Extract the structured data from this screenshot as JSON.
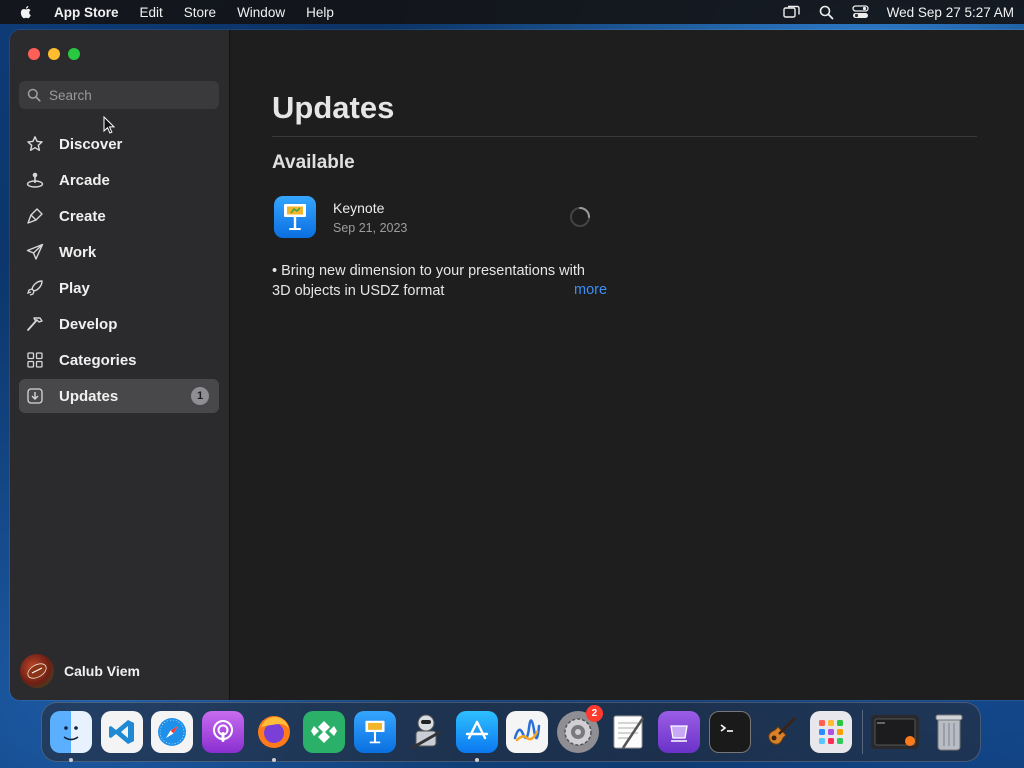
{
  "menubar": {
    "app_name": "App Store",
    "items": [
      "Edit",
      "Store",
      "Window",
      "Help"
    ],
    "clock": "Wed Sep 27  5:27 AM"
  },
  "sidebar": {
    "search_placeholder": "Search",
    "items": [
      {
        "label": "Discover",
        "icon": "star-icon"
      },
      {
        "label": "Arcade",
        "icon": "joystick-icon"
      },
      {
        "label": "Create",
        "icon": "brush-icon"
      },
      {
        "label": "Work",
        "icon": "paper-plane-icon"
      },
      {
        "label": "Play",
        "icon": "rocket-icon"
      },
      {
        "label": "Develop",
        "icon": "hammer-icon"
      },
      {
        "label": "Categories",
        "icon": "grid-icon"
      },
      {
        "label": "Updates",
        "icon": "download-icon",
        "badge": "1",
        "selected": true
      }
    ],
    "user": {
      "name": "Calub Viem"
    }
  },
  "main": {
    "title": "Updates",
    "section": "Available",
    "app": {
      "name": "Keynote",
      "date": "Sep 21, 2023",
      "notes_line1": "• Bring new dimension to your presentations with",
      "notes_line2": "3D objects in USDZ format",
      "more": "more"
    }
  },
  "dock": {
    "apps": [
      "finder-icon",
      "vscode-icon",
      "safari-icon",
      "podcasts-icon",
      "firefox-icon",
      "tableplus-icon",
      "keynote-icon",
      "automator-icon",
      "app-store-icon",
      "freeform-icon",
      "system-settings-icon",
      "textedit-icon",
      "multipass-icon",
      "terminal-icon",
      "garageband-icon",
      "launchpad-icon"
    ],
    "settings_badge": "2"
  },
  "colors": {
    "accent": "#3b8ef5",
    "sidebar_bg": "#2b2b2d",
    "content_bg": "#1e1e1e"
  }
}
